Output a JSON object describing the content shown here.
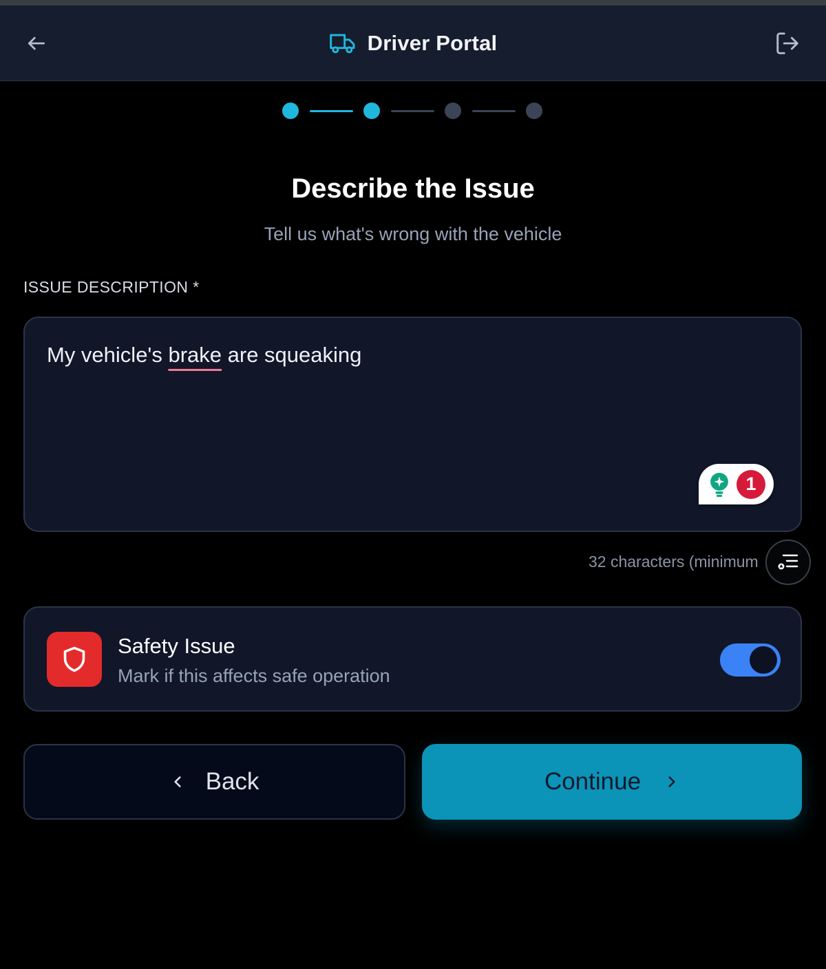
{
  "header": {
    "title": "Driver Portal",
    "back_icon": "arrow-left-icon",
    "logo_icon": "truck-icon",
    "logout_icon": "logout-icon"
  },
  "stepper": {
    "total_steps": 4,
    "completed_steps": 2
  },
  "page": {
    "heading": "Describe the Issue",
    "subheading": "Tell us what's wrong with the vehicle"
  },
  "issue_field": {
    "label": "ISSUE DESCRIPTION *",
    "value_before": "My vehicle's ",
    "value_misspelled": "brake",
    "value_after": " are squeaking",
    "char_count_text": "32 characters (minimum",
    "grammar_issue_count": "1"
  },
  "safety": {
    "title": "Safety Issue",
    "description": "Mark if this affects safe operation",
    "toggle_on": true
  },
  "actions": {
    "back_label": "Back",
    "continue_label": "Continue"
  },
  "colors": {
    "accent": "#1fb8dc",
    "continue_bg": "#0c93b8",
    "toggle_on": "#3b82f6",
    "danger": "#e42b2b"
  }
}
